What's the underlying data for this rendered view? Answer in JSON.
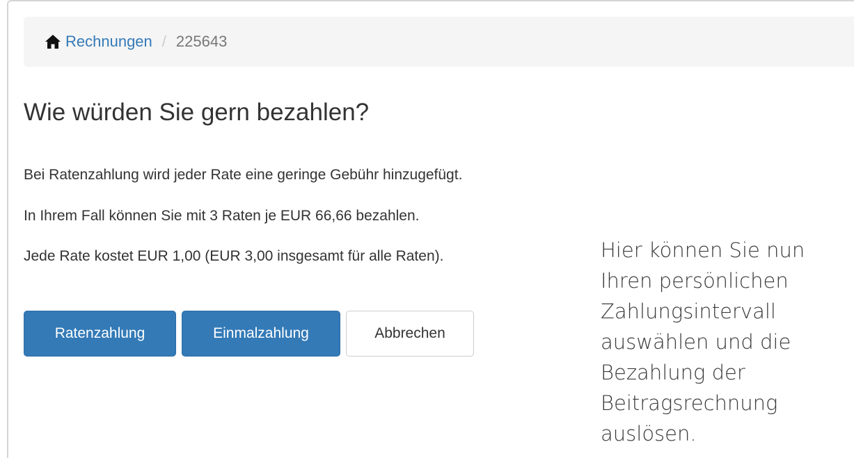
{
  "breadcrumb": {
    "home_icon": "home-icon",
    "link_label": "Rechnungen",
    "separator": "/",
    "current": "225643"
  },
  "heading": "Wie würden Sie gern bezahlen?",
  "paragraphs": [
    "Bei Ratenzahlung wird jeder Rate eine geringe Gebühr hinzugefügt.",
    "In Ihrem Fall können Sie mit 3 Raten je EUR 66,66 bezahlen.",
    "Jede Rate kostet EUR 1,00 (EUR 3,00 insgesamt für alle Raten)."
  ],
  "buttons": {
    "installment": "Ratenzahlung",
    "single": "Einmalzahlung",
    "cancel": "Abbrechen"
  },
  "annotation": {
    "lines": [
      "Hier können Sie nun",
      "Ihren persönlichen",
      "Zahlungsintervall",
      "auswählen und die",
      "Bezahlung der",
      "Beitragsrechnung",
      "auslösen."
    ]
  },
  "colors": {
    "primary": "#337ab7",
    "breadcrumb_bg": "#f5f5f5",
    "link": "#337ab7"
  }
}
